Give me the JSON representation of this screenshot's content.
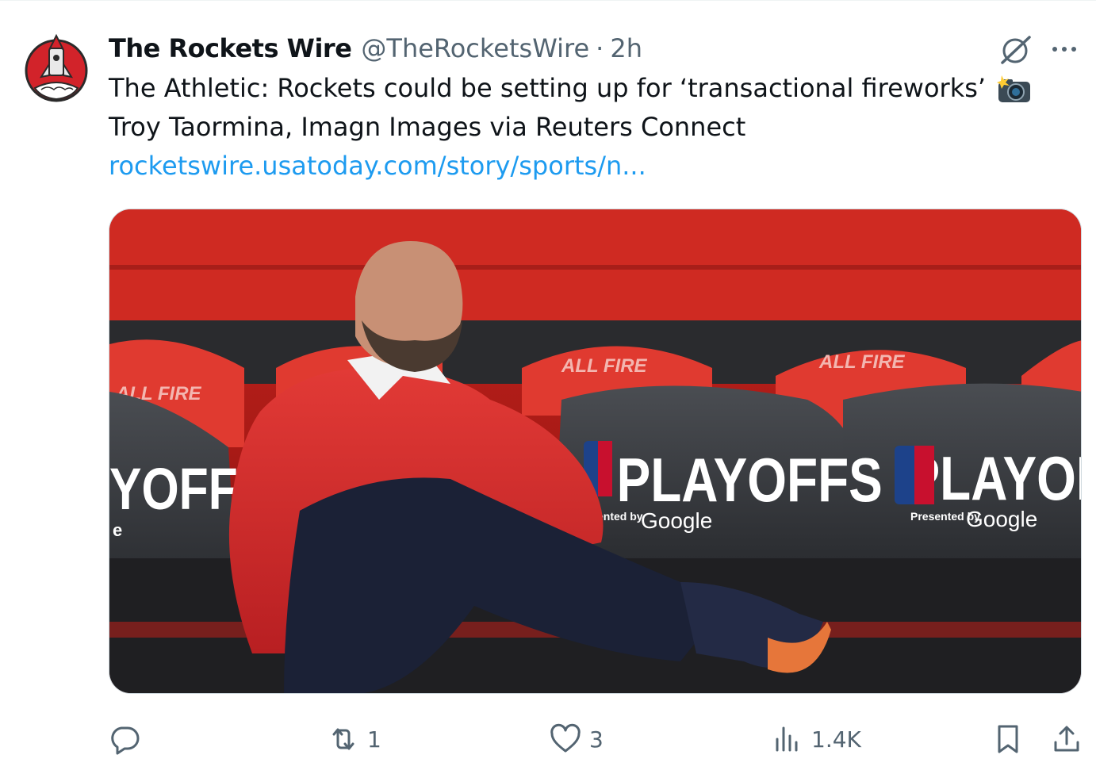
{
  "post": {
    "author": {
      "display_name": "The Rockets Wire",
      "handle": "@TheRocketsWire",
      "separator": "·",
      "time": "2h",
      "avatar_icon": "rocket-logo"
    },
    "text_line1": "The Athletic: Rockets could be setting up for ‘transactional fireworks’",
    "text_emoji": "camera-flash-emoji",
    "text_line2": "Troy Taormina, Imagn Images via Reuters Connect",
    "link": "rocketswire.usatoday.com/story/sports/n...",
    "image": {
      "alt": "Man in red sweater seated courtside in front of playoff chairs",
      "chair_text": "PLAYOFFS",
      "chair_text_partial": "PLAYOI",
      "chair_text_left": "YOFFS",
      "sponsor_text": "Presented by",
      "sponsor_brand": "Google",
      "sponsor_partial": "ented by",
      "seat_text": "ALL FIRE",
      "letter_e": "e"
    }
  },
  "actions": {
    "reply": {
      "icon": "reply-icon",
      "count": ""
    },
    "repost": {
      "icon": "repost-icon",
      "count": "1"
    },
    "like": {
      "icon": "heart-icon",
      "count": "3"
    },
    "views": {
      "icon": "views-icon",
      "count": "1.4K"
    },
    "bookmark": {
      "icon": "bookmark-icon"
    },
    "share": {
      "icon": "share-icon"
    }
  },
  "colors": {
    "link": "#1d9bf0",
    "secondary_text": "#536471",
    "primary_text": "#0f1419",
    "avatar_red": "#d2232a"
  }
}
